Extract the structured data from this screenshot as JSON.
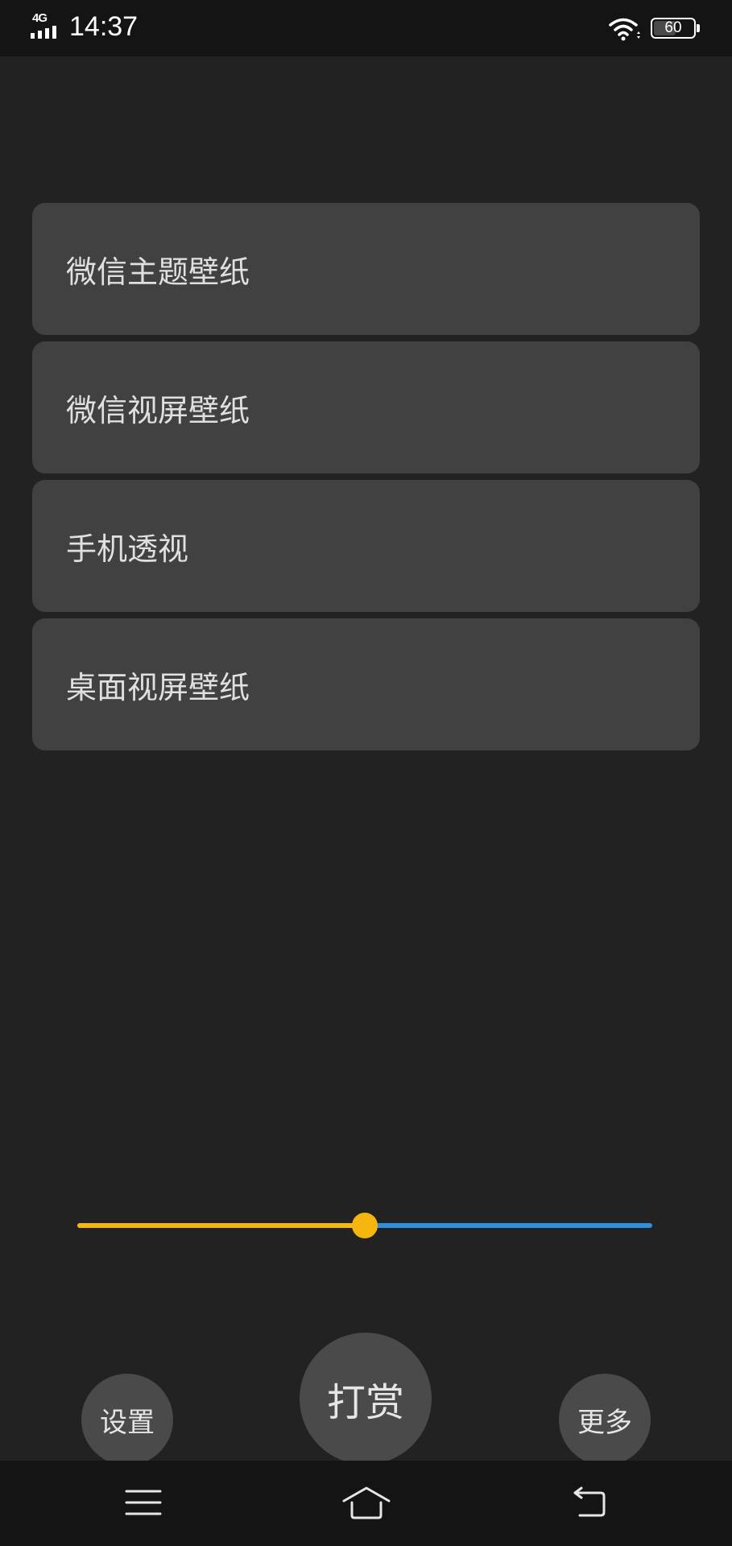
{
  "status_bar": {
    "network": "4G",
    "time": "14:37",
    "battery": "60",
    "icons": [
      "signal-icon",
      "wifi-icon",
      "battery-icon"
    ]
  },
  "menu": {
    "items": [
      {
        "label": "微信主题壁纸"
      },
      {
        "label": "微信视屏壁纸"
      },
      {
        "label": "手机透视"
      },
      {
        "label": "桌面视屏壁纸"
      }
    ]
  },
  "slider": {
    "value": 0.5,
    "fill_color": "#f5b70d",
    "track_color": "#2f8fdd"
  },
  "bottom_buttons": {
    "settings_label": "设置",
    "reward_label": "打赏",
    "more_label": "更多"
  },
  "nav_bar": {
    "icons": [
      "menu-icon",
      "home-icon",
      "back-icon"
    ]
  },
  "colors": {
    "background": "#222222",
    "card": "#414141",
    "bars": "#141414"
  }
}
